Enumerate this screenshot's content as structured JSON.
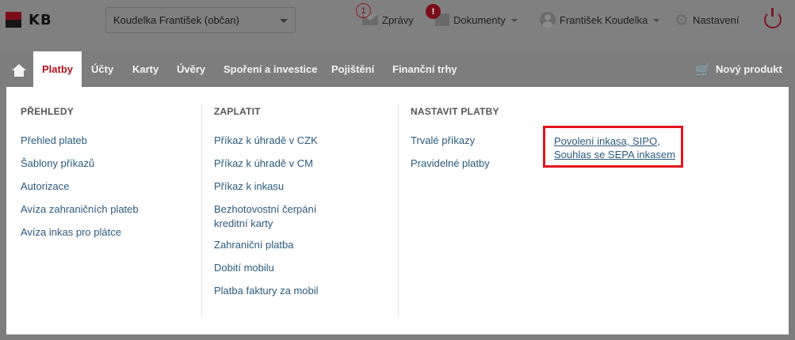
{
  "brand": {
    "logo_text": "KB"
  },
  "profile_select": {
    "value": "Koudelka František (občan)"
  },
  "top": {
    "messages": {
      "label": "Zprávy",
      "count": "1"
    },
    "documents": {
      "label": "Dokumenty",
      "count": "!"
    },
    "user": {
      "label": "František Koudelka"
    },
    "settings": {
      "label": "Nastavení"
    }
  },
  "nav": {
    "tabs": [
      {
        "label": "Platby"
      },
      {
        "label": "Účty"
      },
      {
        "label": "Karty"
      },
      {
        "label": "Úvěry"
      },
      {
        "label": "Spoření a investice"
      },
      {
        "label": "Pojištění"
      },
      {
        "label": "Finanční trhy"
      }
    ],
    "new_product": "Nový produkt"
  },
  "menu": {
    "col1": {
      "heading": "PŘEHLEDY",
      "links": [
        "Přehled plateb",
        "Šablony příkazů",
        "Autorizace",
        "Avíza zahraničních plateb",
        "Avíza inkas pro plátce"
      ]
    },
    "col2": {
      "heading": "ZAPLATIT",
      "links": [
        "Příkaz k úhradě v CZK",
        "Příkaz k úhradě v CM",
        "Příkaz k inkasu",
        "Bezhotovostní čerpání\nkreditní karty",
        "Zahraniční platba",
        "Dobití mobilu",
        "Platba faktury za mobil"
      ]
    },
    "col3": {
      "heading": "NASTAVIT PLATBY",
      "links": [
        "Trvalé příkazy",
        "Pravidelné platby"
      ]
    },
    "highlighted_link": "Povolení inkasa, SIPO,\nSouhlas se SEPA inkasem"
  },
  "colors": {
    "accent_red": "#b0141d",
    "highlight_border": "#e4141f",
    "link": "#2b5a7f"
  }
}
